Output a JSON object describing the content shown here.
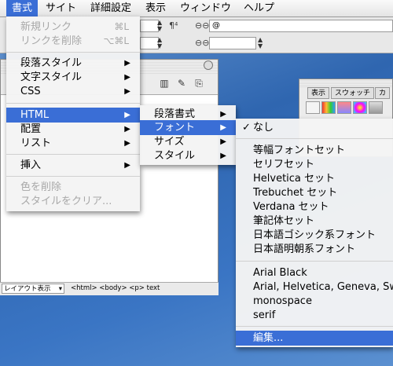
{
  "menubar": {
    "items": [
      "書式",
      "サイト",
      "詳細設定",
      "表示",
      "ウィンドウ",
      "ヘルプ"
    ]
  },
  "format_menu": {
    "new_link": "新規リンク",
    "new_link_shortcut": "⌘L",
    "remove_link": "リンクを削除",
    "remove_link_shortcut": "⌥⌘L",
    "paragraph_style": "段落スタイル",
    "text_style": "文字スタイル",
    "css": "CSS",
    "html": "HTML",
    "layout": "配置",
    "list": "リスト",
    "insert": "挿入",
    "remove_color": "色を削除",
    "clear_style": "スタイルをクリア..."
  },
  "html_submenu": {
    "paragraph_format": "段落書式",
    "font": "フォント",
    "size": "サイズ",
    "style": "スタイル"
  },
  "font_submenu": {
    "checkmark": "✓",
    "items_group1": [
      "なし"
    ],
    "items_group2": [
      "等幅フォントセット",
      "セリフセット",
      "Helvetica セット",
      "Trebuchet セット",
      "Verdana セット",
      "筆記体セット",
      "日本語ゴシック系フォント",
      "日本語明朝系フォント"
    ],
    "items_group3": [
      "Arial Black",
      "Arial, Helvetica, Geneva, Sw",
      "monospace",
      "serif"
    ],
    "edit": "編集..."
  },
  "document": {
    "layout_view": "レイアウト表示",
    "tag_path": "<html> <body> <p> text"
  },
  "panel": {
    "tab_view": "表示",
    "tab_swatch": "スウォッチ",
    "tab_more": "カ"
  },
  "colors": {
    "highlight": "#3a6ed6"
  }
}
